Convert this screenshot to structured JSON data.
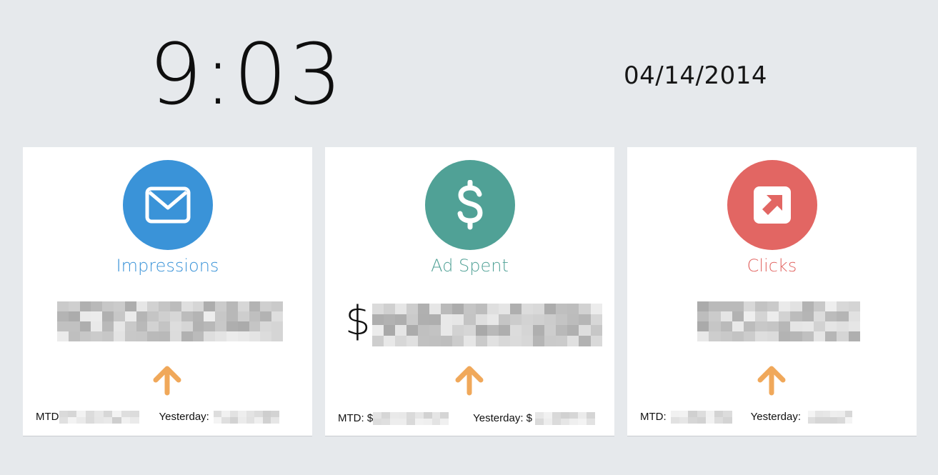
{
  "clock": {
    "time": "9:03"
  },
  "date": {
    "text": "04/14/2014"
  },
  "cards": [
    {
      "title": "Impressions",
      "icon": "envelope-icon",
      "color": "#3a93d8",
      "value_prefix": "",
      "trend": "up",
      "trend_color": "#f0a85a",
      "mtd_label": "MTD",
      "yesterday_label": "Yesterday:"
    },
    {
      "title": "Ad Spent",
      "icon": "dollar-icon",
      "color": "#50a196",
      "value_prefix": "$",
      "trend": "up",
      "trend_color": "#f0a85a",
      "mtd_label": "MTD: $",
      "yesterday_label": "Yesterday: $"
    },
    {
      "title": "Clicks",
      "icon": "external-link-icon",
      "color": "#e26663",
      "value_prefix": "",
      "trend": "up",
      "trend_color": "#f0a85a",
      "mtd_label": "MTD:",
      "yesterday_label": "Yesterday:"
    }
  ]
}
